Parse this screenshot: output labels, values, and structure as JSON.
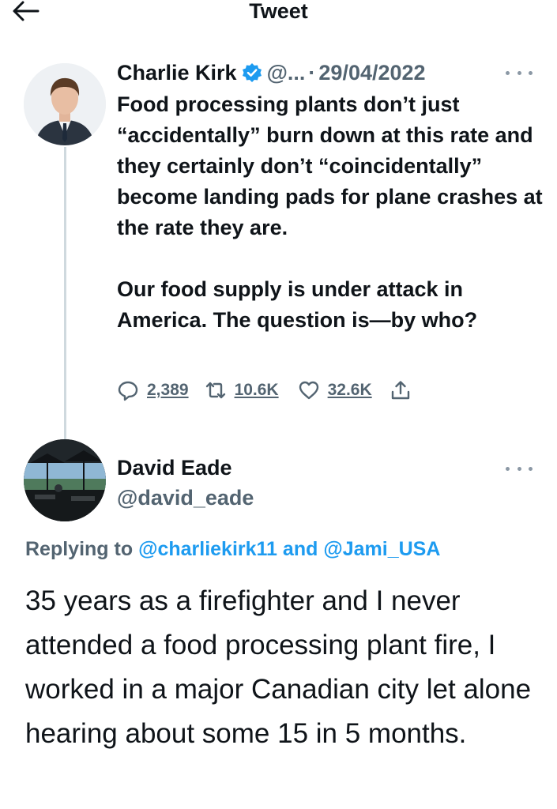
{
  "header": {
    "title": "Tweet",
    "back_icon": "arrow-left-icon"
  },
  "tweet": {
    "author_name": "Charlie Kirk",
    "verified_icon": "verified-badge-icon",
    "handle": "@...",
    "separator": "·",
    "date": "29/04/2022",
    "text_paragraphs": [
      "Food processing plants don’t just “accidentally” burn down at this rate and they certainly don’t “coincidentally” become landing pads for plane crashes at the rate they are.",
      "Our food supply is under attack in America. The question is—by who?"
    ],
    "actions": {
      "reply_count": "2,389",
      "retweet_count": "10.6K",
      "like_count": "32.6K"
    }
  },
  "reply": {
    "author_name": "David Eade",
    "handle": "@david_eade",
    "replying_prefix": "Replying to",
    "mention_1": "@charliekirk11",
    "conjunction": "and",
    "mention_2": "@Jami_USA",
    "text": "35 years as a firefighter and I never attended a food processing plant fire, I worked in a major Canadian city let alone hearing about some 15 in 5 months."
  },
  "colors": {
    "text": "#0f1419",
    "secondary": "#536471",
    "accent": "#1d9bf0",
    "thread_line": "#cfd9de"
  }
}
